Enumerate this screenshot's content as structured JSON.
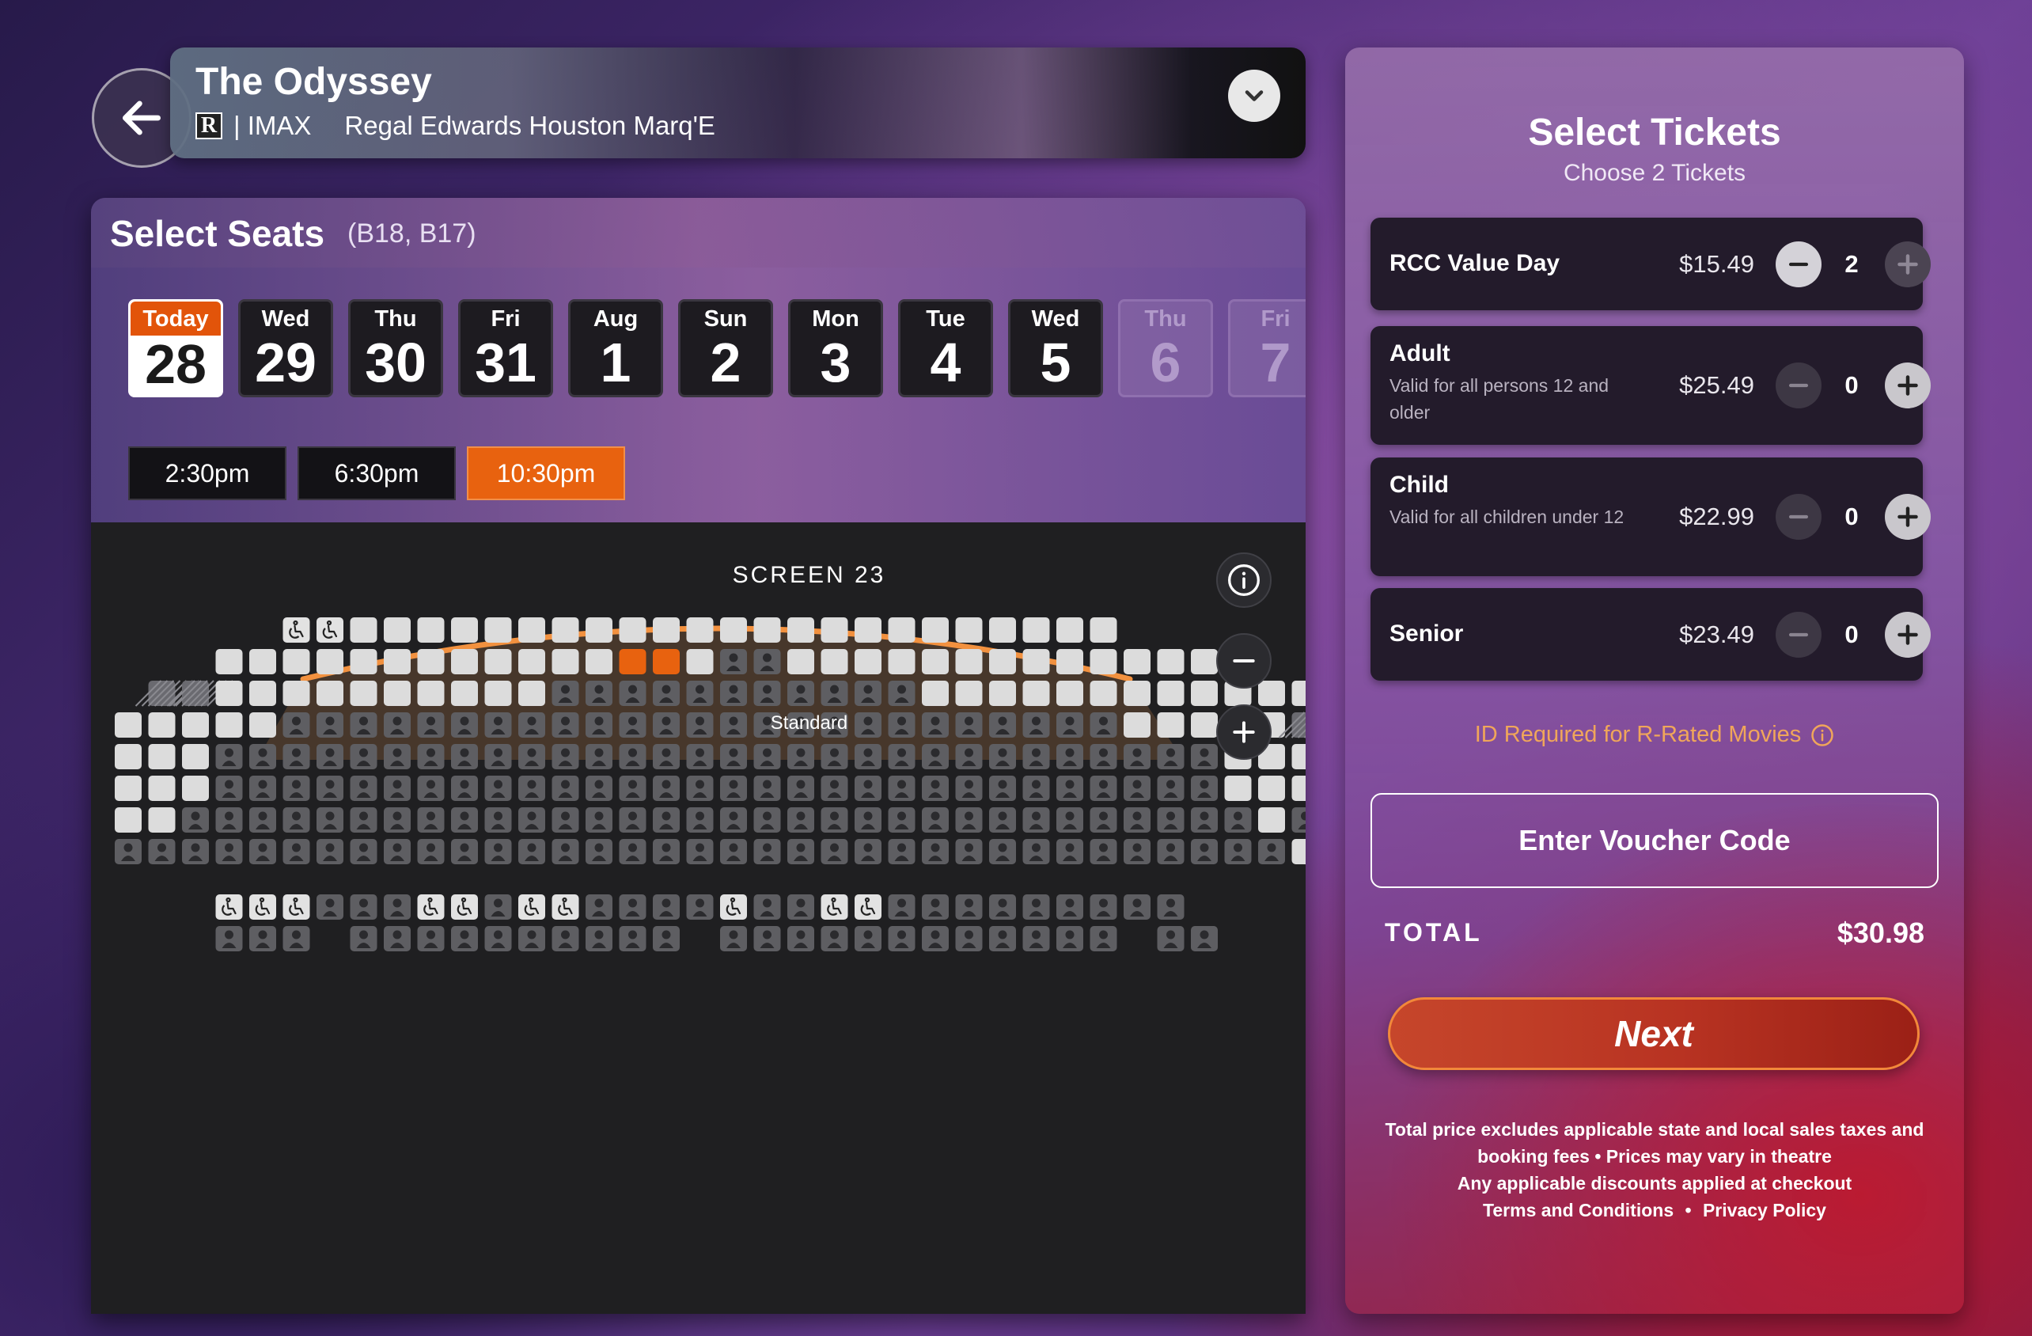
{
  "movie": {
    "title": "The Odyssey",
    "rating": "R",
    "format": "| IMAX",
    "theatre": "Regal Edwards Houston Marq'E"
  },
  "seat_selection": {
    "title": "Select Seats",
    "selected_seats": "(B18, B17)",
    "dates": [
      {
        "dow": "Today",
        "day": "28",
        "state": "selected"
      },
      {
        "dow": "Wed",
        "day": "29",
        "state": "available"
      },
      {
        "dow": "Thu",
        "day": "30",
        "state": "available"
      },
      {
        "dow": "Fri",
        "day": "31",
        "state": "available"
      },
      {
        "dow": "Aug",
        "day": "1",
        "state": "available"
      },
      {
        "dow": "Sun",
        "day": "2",
        "state": "available"
      },
      {
        "dow": "Mon",
        "day": "3",
        "state": "available"
      },
      {
        "dow": "Tue",
        "day": "4",
        "state": "available"
      },
      {
        "dow": "Wed",
        "day": "5",
        "state": "available"
      },
      {
        "dow": "Thu",
        "day": "6",
        "state": "disabled"
      },
      {
        "dow": "Fri",
        "day": "7",
        "state": "disabled"
      }
    ],
    "showtimes": [
      {
        "label": "2:30pm",
        "active": false
      },
      {
        "label": "6:30pm",
        "active": false
      },
      {
        "label": "10:30pm",
        "active": true
      }
    ],
    "screen_label": "SCREEN 23",
    "section_label": "Standard"
  },
  "tickets": {
    "title": "Select Tickets",
    "subtitle": "Choose 2 Tickets",
    "types": [
      {
        "name": "RCC Value Day",
        "desc": "",
        "price": "$15.49",
        "qty": "2"
      },
      {
        "name": "Adult",
        "desc": "Valid for all persons 12 and older",
        "price": "$25.49",
        "qty": "0"
      },
      {
        "name": "Child",
        "desc": "Valid for all children under 12",
        "price": "$22.99",
        "qty": "0"
      },
      {
        "name": "Senior",
        "desc": "",
        "price": "$23.49",
        "qty": "0"
      }
    ],
    "id_notice": "ID Required for R-Rated Movies",
    "voucher_label": "Enter Voucher Code",
    "total_label": "TOTAL",
    "total_value": "$30.98",
    "next_label": "Next",
    "footer_line1": "Total price excludes applicable state and local sales taxes and",
    "footer_line2": "booking fees  •  Prices may vary in theatre",
    "footer_line3": "Any applicable discounts applied at checkout",
    "footer_terms": "Terms and Conditions",
    "footer_sep": "•",
    "footer_privacy": "Privacy Policy"
  },
  "colors": {
    "accent": "#e8620f",
    "seat_available": "#dcdcdc",
    "seat_taken": "#5e5e62",
    "seat_selected": "#e8620f",
    "screen_arc": "#f2913f",
    "id_notice": "#f0a65a"
  }
}
